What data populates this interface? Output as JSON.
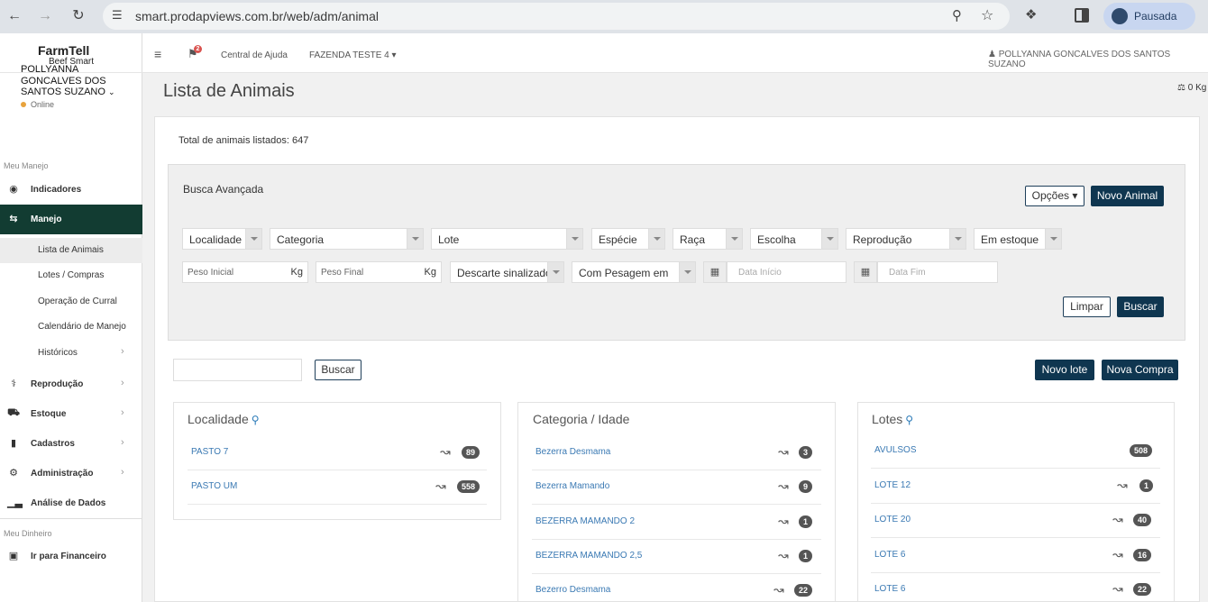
{
  "browser": {
    "url": "smart.prodapviews.com.br/web/adm/animal",
    "profile_label": "Pausada"
  },
  "brand": {
    "name": "FarmTell",
    "tagline": "Beef Smart"
  },
  "sidebar": {
    "user_name": "POLLYANNA GONCALVES DOS SANTOS SUZANO",
    "user_status": "Online",
    "section_1": "Meu Manejo",
    "items": [
      {
        "label": "Indicadores"
      },
      {
        "label": "Manejo"
      }
    ],
    "submenu": [
      {
        "label": "Lista de Animais"
      },
      {
        "label": "Lotes / Compras"
      },
      {
        "label": "Operação de Curral"
      },
      {
        "label": "Calendário de Manejo"
      },
      {
        "label": "Históricos"
      }
    ],
    "items_2": [
      {
        "label": "Reprodução"
      },
      {
        "label": "Estoque"
      },
      {
        "label": "Cadastros"
      },
      {
        "label": "Administração"
      },
      {
        "label": "Análise de Dados"
      }
    ],
    "section_2": "Meu Dinheiro",
    "finance": "Ir para Financeiro"
  },
  "topbar": {
    "bell_count": "2",
    "help": "Central de Ajuda",
    "farm": "FAZENDA TESTE 4",
    "user": "POLLYANNA GONCALVES DOS SANTOS SUZANO"
  },
  "main": {
    "title": "Lista de Animais",
    "weight": "0 Kg",
    "total": "Total de animais listados: 647",
    "search_title": "Busca Avançada",
    "options_btn": "Opções",
    "new_animal_btn": "Novo Animal",
    "filters_row1": [
      "Localidade",
      "Categoria",
      "Lote",
      "Espécie",
      "Raça",
      "Escolha",
      "Reprodução",
      "Em estoque"
    ],
    "peso_inicial": "Peso Inicial",
    "peso_final": "Peso Final",
    "kg": "Kg",
    "descarte": "Descarte sinalizado",
    "pesagem": "Com Pesagem em",
    "data_inicio": "Data Início",
    "data_fim": "Data Fim",
    "limpar_btn": "Limpar",
    "buscar_btn": "Buscar",
    "quick_buscar_btn": "Buscar",
    "novo_lote_btn": "Novo lote",
    "nova_compra_btn": "Nova Compra"
  },
  "cards": {
    "localidade": {
      "title": "Localidade",
      "rows": [
        {
          "label": "PASTO 7",
          "count": "89"
        },
        {
          "label": "PASTO UM",
          "count": "558"
        }
      ]
    },
    "categoria": {
      "title": "Categoria / Idade",
      "rows": [
        {
          "label": "Bezerra Desmama",
          "count": "3"
        },
        {
          "label": "Bezerra Mamando",
          "count": "9"
        },
        {
          "label": "BEZERRA MAMANDO 2",
          "count": "1"
        },
        {
          "label": "BEZERRA MAMANDO 2,5",
          "count": "1"
        },
        {
          "label": "Bezerro Desmama",
          "count": "22"
        }
      ]
    },
    "lotes": {
      "title": "Lotes",
      "rows": [
        {
          "label": "AVULSOS",
          "count": "508"
        },
        {
          "label": "LOTE 12",
          "count": "1"
        },
        {
          "label": "LOTE 20",
          "count": "40"
        },
        {
          "label": "LOTE 6",
          "count": "16"
        },
        {
          "label": "LOTE 6",
          "count": "22"
        }
      ]
    }
  }
}
